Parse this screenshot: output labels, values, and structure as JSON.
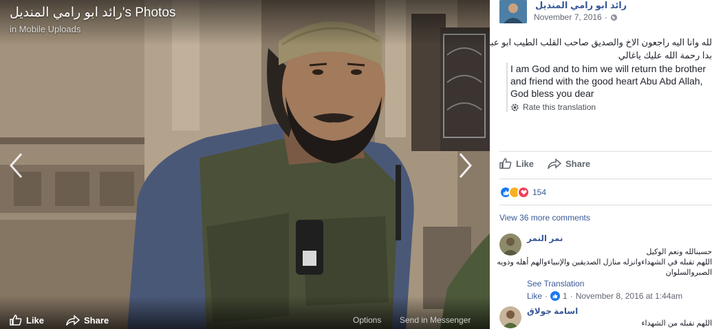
{
  "viewer": {
    "album_title": "رائد ابو رامي المنديل's Photos",
    "album_subtitle": "in Mobile Uploads",
    "like_label": "Like",
    "share_label": "Share",
    "options_label": "Options",
    "send_label": "Send in Messenger"
  },
  "post": {
    "author": "رائد ابو رامي المنديل",
    "date": "November 7, 2016",
    "privacy": "·",
    "text_ar": [
      "لله وانا اليه راجعون الاخ والصديق صاحب القلب الطيب ابو عبد",
      "بدا رحمة الله عليك ياغالي"
    ],
    "translation_lines": [
      "I am God and to him we will return the brother",
      "and friend with the good heart Abu Abd Allah,",
      "God bless you dear"
    ],
    "rate_label": "Rate this translation",
    "like_label": "Like",
    "share_label": "Share",
    "reaction_count": "154",
    "view_more": "View 36 more comments"
  },
  "comments": [
    {
      "name": "نمر النمر",
      "lines": [
        "حسبنالله ونعم الوكيل",
        "اللهم تقبله في الشهداءوانزله منازل الصديقين والإنبياءوالهم أهله وذويه",
        "الصبروالسلوان"
      ],
      "see_translation": "See Translation",
      "like": "Like",
      "count": "1",
      "date": "November 8, 2016 at 1:44am"
    },
    {
      "name": "اسامة جولاق",
      "lines": [
        "اللهم تقبله من الشهداء"
      ]
    }
  ],
  "colors": {
    "link": "#385898",
    "meta": "#616770",
    "like_blue": "#1877f2",
    "love_red": "#f33e58",
    "haha_yellow": "#f7b125"
  }
}
